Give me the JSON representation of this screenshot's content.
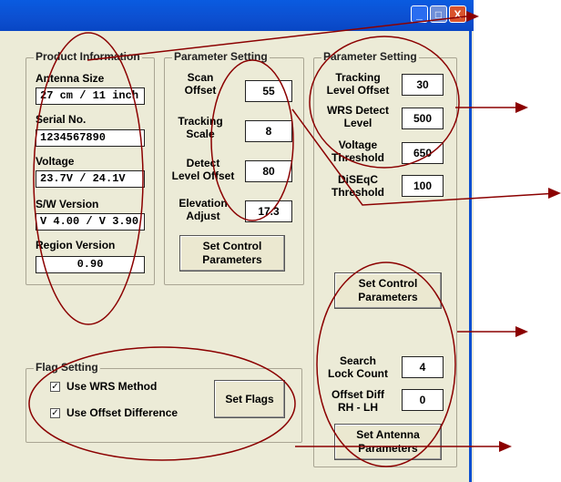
{
  "titlebar": {
    "min": "_",
    "max": "□",
    "close": "X"
  },
  "product": {
    "title": "Product Information",
    "antenna_label": "Antenna Size",
    "antenna_value": "27 cm / 11 inch",
    "serial_label": "Serial No.",
    "serial_value": "1234567890",
    "voltage_label": "Voltage",
    "voltage_value": "23.7V / 24.1V",
    "sw_label": "S/W Version",
    "sw_value": "V 4.00 / V 3.90",
    "region_label": "Region Version",
    "region_value": "0.90"
  },
  "param1": {
    "title": "Parameter Setting",
    "scan_label_1": "Scan",
    "scan_label_2": "Offset",
    "scan_value": "55",
    "tracking_label_1": "Tracking",
    "tracking_label_2": "Scale",
    "tracking_value": "8",
    "detect_label_1": "Detect",
    "detect_label_2": "Level Offset",
    "detect_value": "80",
    "elev_label_1": "Elevation",
    "elev_label_2": "Adjust",
    "elev_value": "17.3",
    "button_1": "Set Control",
    "button_2": "Parameters"
  },
  "param2": {
    "title": "Parameter Setting",
    "tlo_label_1": "Tracking",
    "tlo_label_2": "Level Offset",
    "tlo_value": "30",
    "wrs_label_1": "WRS Detect",
    "wrs_label_2": "Level",
    "wrs_value": "500",
    "volt_label_1": "Voltage",
    "volt_label_2": "Threshold",
    "volt_value": "650",
    "diseqc_label_1": "DiSEqC",
    "diseqc_label_2": "Threshold",
    "diseqc_value": "100",
    "button_1": "Set Control",
    "button_2": "Parameters",
    "search_label_1": "Search",
    "search_label_2": "Lock Count",
    "search_value": "4",
    "offset_label_1": "Offset Diff",
    "offset_label_2": "RH - LH",
    "offset_value": "0",
    "antenna_btn_1": "Set Antenna",
    "antenna_btn_2": "Parameters"
  },
  "flags": {
    "title": "Flag Setting",
    "wrs_method": "Use WRS Method",
    "wrs_checked": true,
    "offset_diff": "Use Offset Difference",
    "offset_checked": true,
    "button": "Set Flags"
  },
  "annotation": {
    "color": "#8b0000"
  }
}
